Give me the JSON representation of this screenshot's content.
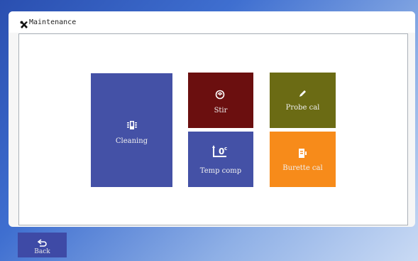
{
  "window": {
    "title": "Maintenance",
    "title_icon": "wrench-cross-icon"
  },
  "tiles": [
    {
      "label": "Cleaning",
      "icon": "cleaning-icon",
      "color": "#4451a6"
    },
    {
      "label": "Stir",
      "icon": "stir-icon",
      "color": "#6b0f0f"
    },
    {
      "label": "Probe cal",
      "icon": "pencil-icon",
      "color": "#6b6b14"
    },
    {
      "label": "Temp comp",
      "icon": "temperature-comp-icon",
      "color": "#4451a6"
    },
    {
      "label": "Burette cal",
      "icon": "burette-icon",
      "color": "#f78b1a"
    }
  ],
  "footer": {
    "back_label": "Back",
    "back_icon": "back-arrow-icon",
    "back_color": "#3e4aa6"
  }
}
